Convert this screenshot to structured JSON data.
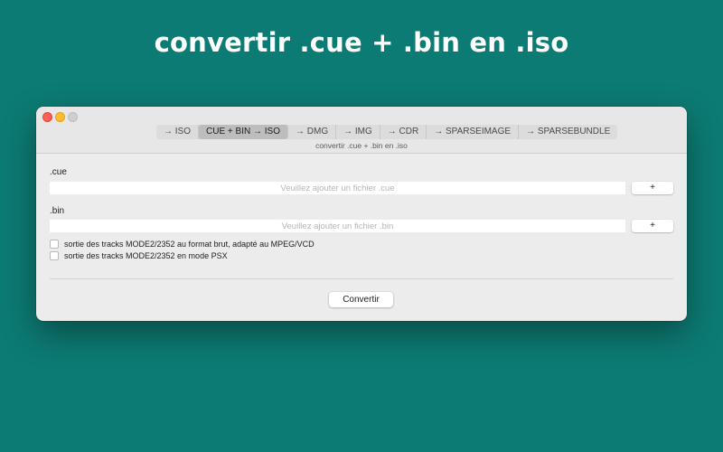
{
  "hero": {
    "title": "convertir .cue + .bin en .iso"
  },
  "window": {
    "tabs": [
      {
        "label": "→ ISO",
        "active": false
      },
      {
        "label": "CUE + BIN → ISO",
        "active": true
      },
      {
        "label": "→ DMG",
        "active": false
      },
      {
        "label": "→ IMG",
        "active": false
      },
      {
        "label": "→ CDR",
        "active": false
      },
      {
        "label": "→ SPARSEIMAGE",
        "active": false
      },
      {
        "label": "→ SPARSEBUNDLE",
        "active": false
      }
    ],
    "subtitle": "convertir .cue + .bin en .iso"
  },
  "cue": {
    "label": ".cue",
    "value": "",
    "placeholder": "Veuillez ajouter un fichier .cue",
    "add_label": "+"
  },
  "bin": {
    "label": ".bin",
    "value": "",
    "placeholder": "Veuillez ajouter un fichier .bin",
    "add_label": "+"
  },
  "options": [
    {
      "label": "sortie des tracks MODE2/2352 au format brut, adapté au MPEG/VCD",
      "checked": false
    },
    {
      "label": "sortie des tracks MODE2/2352 en mode PSX",
      "checked": false
    }
  ],
  "actions": {
    "convert_label": "Convertir"
  },
  "colors": {
    "background": "#0c7b73",
    "window": "#ececec",
    "close": "#fe5f57",
    "minimize": "#febc2e"
  }
}
